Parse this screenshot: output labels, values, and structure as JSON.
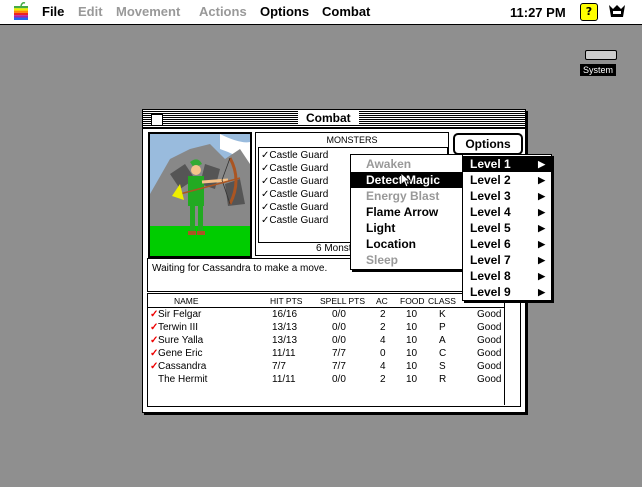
{
  "menubar": {
    "items": [
      {
        "label": "File",
        "enabled": true
      },
      {
        "label": "Edit",
        "enabled": false
      },
      {
        "label": "Movement",
        "enabled": false
      },
      {
        "label": "Actions",
        "enabled": false
      },
      {
        "label": "Options",
        "enabled": true
      },
      {
        "label": "Combat",
        "enabled": true
      }
    ],
    "clock": "11:27 PM",
    "help_glyph": "?"
  },
  "desktop": {
    "disk_label": "System"
  },
  "window": {
    "title": "Combat",
    "monsters_header": "MONSTERS",
    "monsters": [
      "✓Castle Guard",
      "✓Castle Guard",
      "✓Castle Guard",
      "✓Castle Guard",
      "✓Castle Guard",
      "✓Castle Guard"
    ],
    "monster_count": "6 Monst",
    "options_label": "Options",
    "status": "Waiting for Cassandra to make a move.",
    "party_headers": [
      "NAME",
      "HIT PTS",
      "SPELL PTS",
      "AC",
      "FOOD",
      "CLASS"
    ],
    "party": [
      {
        "check": "✓",
        "name": "Sir Felgar",
        "hp": "16/16",
        "sp": "0/0",
        "ac": "2",
        "food": "10",
        "cls": "K",
        "status": "Good"
      },
      {
        "check": "✓",
        "name": "Terwin III",
        "hp": "13/13",
        "sp": "0/0",
        "ac": "2",
        "food": "10",
        "cls": "P",
        "status": "Good"
      },
      {
        "check": "✓",
        "name": "Sure Yalla",
        "hp": "13/13",
        "sp": "0/0",
        "ac": "4",
        "food": "10",
        "cls": "A",
        "status": "Good"
      },
      {
        "check": "✓",
        "name": "Gene Eric",
        "hp": "11/11",
        "sp": "7/7",
        "ac": "0",
        "food": "10",
        "cls": "C",
        "status": "Good"
      },
      {
        "check": "✓",
        "name": "Cassandra",
        "hp": "7/7",
        "sp": "7/7",
        "ac": "4",
        "food": "10",
        "cls": "S",
        "status": "Good"
      },
      {
        "check": "",
        "name": "The Hermit",
        "hp": "11/11",
        "sp": "0/0",
        "ac": "2",
        "food": "10",
        "cls": "R",
        "status": "Good"
      }
    ]
  },
  "spell_menu": {
    "items": [
      {
        "label": "Awaken",
        "state": "dim"
      },
      {
        "label": "Detect Magic",
        "state": "sel"
      },
      {
        "label": "Energy Blast",
        "state": "dim"
      },
      {
        "label": "Flame Arrow",
        "state": "on"
      },
      {
        "label": "Light",
        "state": "on"
      },
      {
        "label": "Location",
        "state": "on"
      },
      {
        "label": "Sleep",
        "state": "dim"
      }
    ]
  },
  "level_menu": {
    "items": [
      "Level 1",
      "Level 2",
      "Level 3",
      "Level 4",
      "Level 5",
      "Level 6",
      "Level 7",
      "Level 8",
      "Level 9"
    ],
    "selected_index": 0,
    "arrow_glyph": "▶"
  }
}
